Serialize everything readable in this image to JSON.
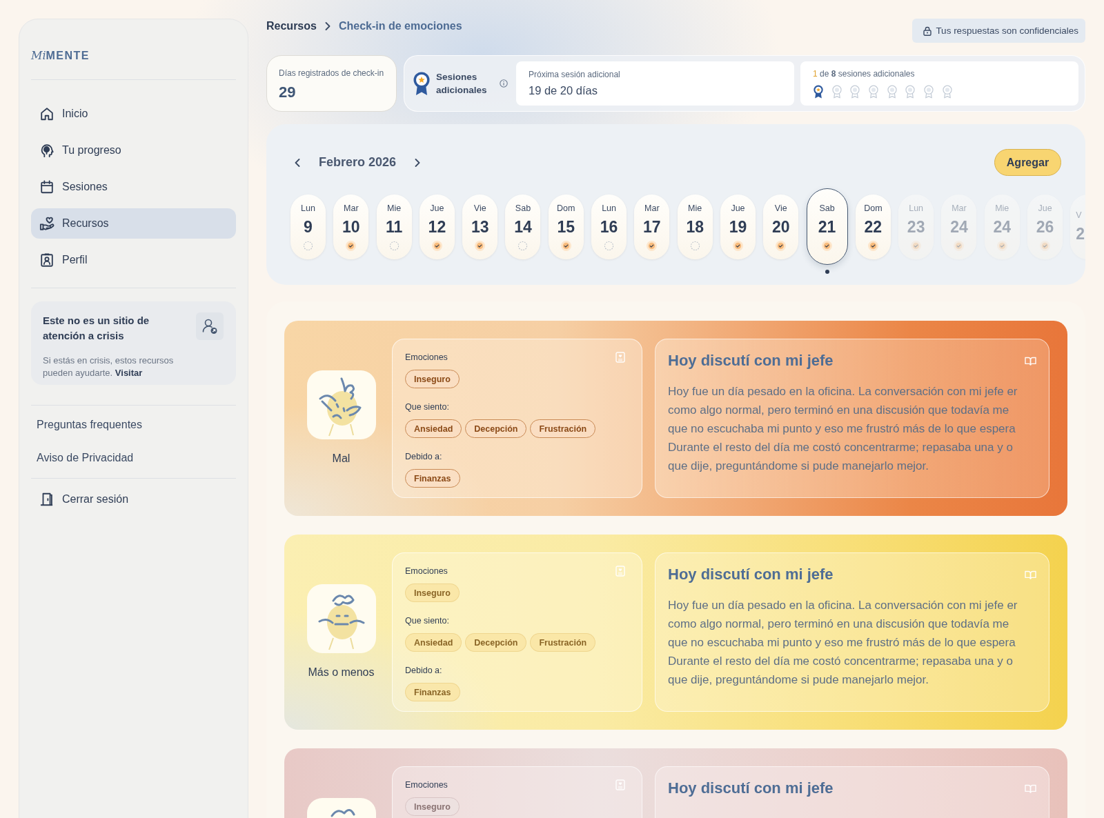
{
  "sidebar": {
    "logo": {
      "script": "Mi",
      "caps": "MENTE"
    },
    "nav": [
      {
        "label": "Inicio",
        "selected": false
      },
      {
        "label": "Tu progreso",
        "selected": false
      },
      {
        "label": "Sesiones",
        "selected": false
      },
      {
        "label": "Recursos",
        "selected": true
      },
      {
        "label": "Perfil",
        "selected": false
      }
    ],
    "crisis": {
      "title": "Este no es un sitio de atención a crisis",
      "body": "Si estás en crisis, estos recursos pueden ayudarte.",
      "link": "Visitar"
    },
    "links": [
      "Preguntas frequentes",
      "Aviso de Privacidad"
    ],
    "logout": "Cerrar sesión"
  },
  "breadcrumb": [
    "Recursos",
    "Check-in de emociones"
  ],
  "privacy_note": "Tus respuestas son confidenciales",
  "stats": {
    "checkin_days": {
      "label": "Días registrados de check-in",
      "value": "29"
    },
    "extra_sessions": {
      "label": "Sesiones adicionales",
      "next_session": {
        "label": "Próxima sesión adicional",
        "value": "19 de 20 días"
      },
      "progress": {
        "count": "1",
        "text": "de **8** sesiones adicionales",
        "badges": [
          {
            "earned": true
          },
          {
            "earned": false
          },
          {
            "earned": false
          },
          {
            "earned": false
          },
          {
            "earned": false
          },
          {
            "earned": false
          },
          {
            "earned": false
          },
          {
            "earned": false
          }
        ]
      }
    }
  },
  "calendar": {
    "month": "Febrero 2026",
    "add_button": "Agregar",
    "days": [
      {
        "weekday": "Lun",
        "day": "9",
        "checked": false,
        "selected": false,
        "disabled": false
      },
      {
        "weekday": "Mar",
        "day": "10",
        "checked": true,
        "selected": false,
        "disabled": false
      },
      {
        "weekday": "Mie",
        "day": "11",
        "checked": false,
        "selected": false,
        "disabled": false
      },
      {
        "weekday": "Jue",
        "day": "12",
        "checked": true,
        "selected": false,
        "disabled": false
      },
      {
        "weekday": "Vie",
        "day": "13",
        "checked": true,
        "selected": false,
        "disabled": false
      },
      {
        "weekday": "Sab",
        "day": "14",
        "checked": false,
        "selected": false,
        "disabled": false
      },
      {
        "weekday": "Dom",
        "day": "15",
        "checked": true,
        "selected": false,
        "disabled": false
      },
      {
        "weekday": "Lun",
        "day": "16",
        "checked": false,
        "selected": false,
        "disabled": false
      },
      {
        "weekday": "Mar",
        "day": "17",
        "checked": true,
        "selected": false,
        "disabled": false
      },
      {
        "weekday": "Mie",
        "day": "18",
        "checked": false,
        "selected": false,
        "disabled": false
      },
      {
        "weekday": "Jue",
        "day": "19",
        "checked": true,
        "selected": false,
        "disabled": false
      },
      {
        "weekday": "Vie",
        "day": "20",
        "checked": true,
        "selected": false,
        "disabled": false
      },
      {
        "weekday": "Sab",
        "day": "21",
        "checked": true,
        "selected": true,
        "disabled": false
      },
      {
        "weekday": "Dom",
        "day": "22",
        "checked": true,
        "selected": false,
        "disabled": false
      },
      {
        "weekday": "Lun",
        "day": "23",
        "checked": true,
        "selected": false,
        "disabled": true
      },
      {
        "weekday": "Mar",
        "day": "24",
        "checked": true,
        "selected": false,
        "disabled": true
      },
      {
        "weekday": "Mie",
        "day": "24",
        "checked": true,
        "selected": false,
        "disabled": true
      },
      {
        "weekday": "Jue",
        "day": "26",
        "checked": true,
        "selected": false,
        "disabled": true
      },
      {
        "weekday": "V",
        "day": "2",
        "selected": false,
        "disabled": true
      }
    ]
  },
  "entries": [
    {
      "kind": "bad",
      "mood": "Mal",
      "sections": [
        {
          "label": "Emociones",
          "tags": [
            "Inseguro"
          ]
        },
        {
          "label": "Que siento:",
          "tags": [
            "Ansiedad",
            "Decepción",
            "Frustración"
          ]
        },
        {
          "label": "Debido a:",
          "tags": [
            "Finanzas"
          ]
        }
      ],
      "title": "Hoy discutí con mi jefe",
      "body_lines": [
        "Hoy fue un día pesado en la oficina. La conversación con mi jefe er",
        "como algo normal, pero terminó en una discusión que todavía me",
        "que no escuchaba mi punto y eso me frustró más de lo que espera",
        "Durante el resto del día me costó concentrarme; repasaba una y o",
        "que dije, preguntándome si pude manejarlo mejor."
      ]
    },
    {
      "kind": "okay",
      "mood": "Más o menos",
      "sections": [
        {
          "label": "Emociones",
          "tags": [
            "Inseguro"
          ]
        },
        {
          "label": "Que siento:",
          "tags": [
            "Ansiedad",
            "Decepción",
            "Frustración"
          ]
        },
        {
          "label": "Debido a:",
          "tags": [
            "Finanzas"
          ]
        }
      ],
      "title": "Hoy discutí con mi jefe",
      "body_lines": [
        "Hoy fue un día pesado en la oficina. La conversación con mi jefe er",
        "como algo normal, pero terminó en una discusión que todavía me",
        "que no escuchaba mi punto y eso me frustró más de lo que espera",
        "Durante el resto del día me costó concentrarme; repasaba una y o",
        "que dije, preguntándome si pude manejarlo mejor."
      ]
    },
    {
      "kind": "low",
      "sections": [
        {
          "label": "Emociones",
          "tags": [
            "Inseguro"
          ]
        }
      ],
      "title": "Hoy discutí con mi jefe"
    }
  ]
}
